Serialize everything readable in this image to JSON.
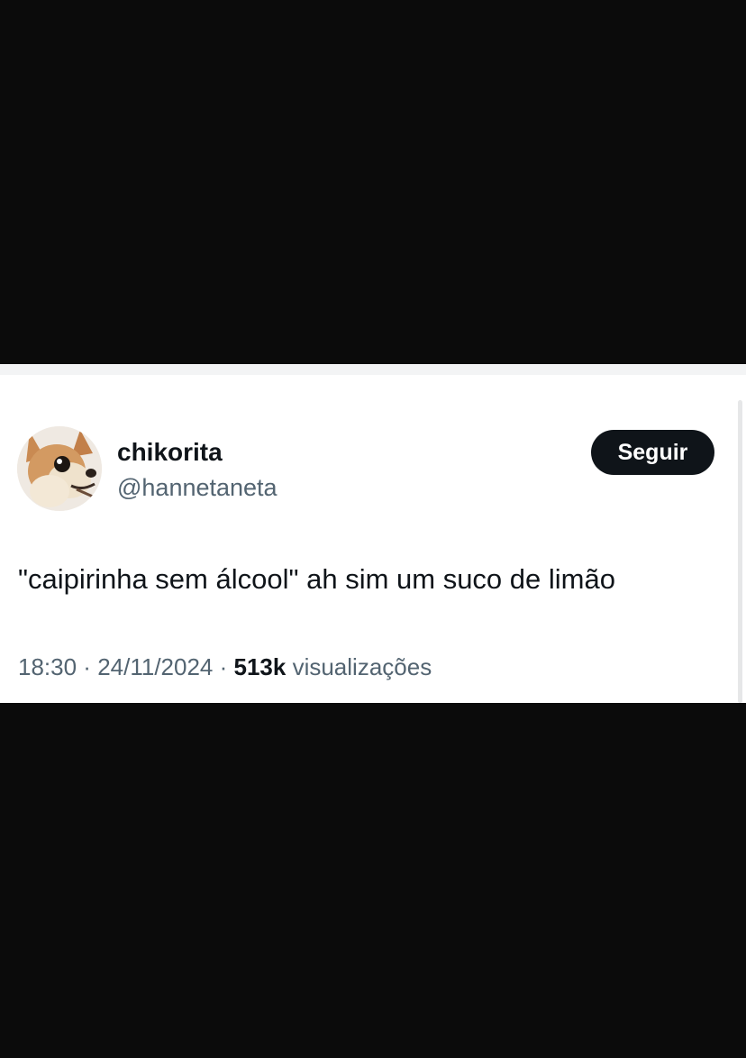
{
  "tweet": {
    "author": {
      "display_name": "chikorita",
      "handle": "@hannetaneta",
      "avatar": "chihuahua-photo"
    },
    "follow_button_label": "Seguir",
    "text": "\"caipirinha sem álcool\" ah sim um suco de limão",
    "meta": {
      "time": "18:30",
      "separator": " · ",
      "date": "24/11/2024",
      "views_count": "513k",
      "views_label": " visualizações"
    }
  },
  "colors": {
    "background": "#0b0b0b",
    "card": "#ffffff",
    "primary_text": "#0f1419",
    "secondary_text": "#536471",
    "button": "#0f1419"
  }
}
